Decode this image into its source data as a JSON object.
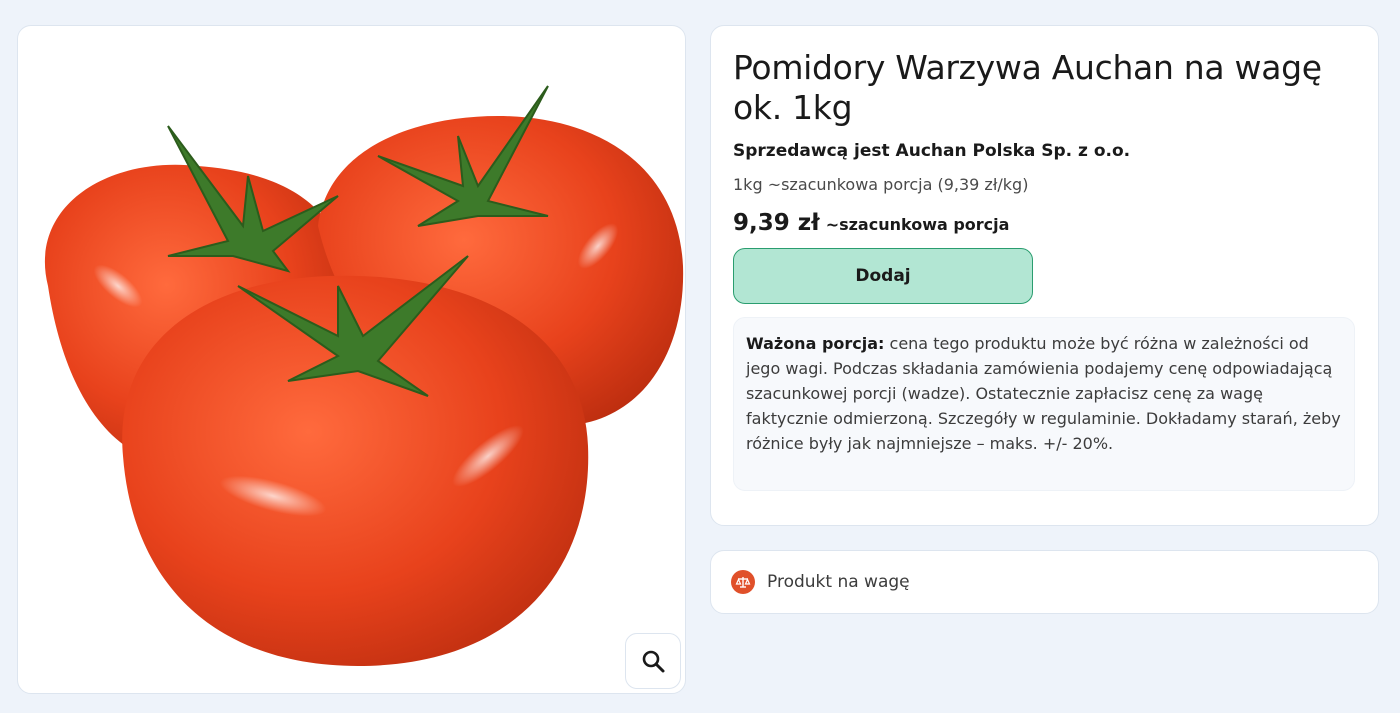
{
  "product": {
    "image_alt": "Pomidory",
    "title": "Pomidory Warzywa Auchan na wagę ok. 1kg",
    "seller": "Sprzedawcą jest Auchan Polska Sp. z o.o.",
    "unit_price": "1kg ~szacunkowa porcja (9,39 zł/kg)",
    "price": "9,39 zł",
    "price_note": "~szacunkowa porcja"
  },
  "actions": {
    "add_label": "Dodaj",
    "zoom_icon": "search-icon"
  },
  "notice": {
    "heading": "Ważona porcja:",
    "text": " cena tego produktu może być różna w zależności od jego wagi. Podczas składania zamówienia podajemy cenę odpowiadającą szacunkowej porcji (wadze). Ostatecznie zapłacisz cenę za wagę faktycznie odmierzoną. Szczegóły w regulaminie. Dokładamy starań, żeby różnice były jak najmniejsze – maks. +/- 20%."
  },
  "feature": {
    "icon": "scale-icon",
    "label": "Produkt na wagę"
  },
  "colors": {
    "background": "#eef3fa",
    "add_button_bg": "#b2e6d3",
    "add_button_border": "#2a9d6f",
    "badge_orange": "#e0502a",
    "tomato_red": "#e8421c"
  }
}
